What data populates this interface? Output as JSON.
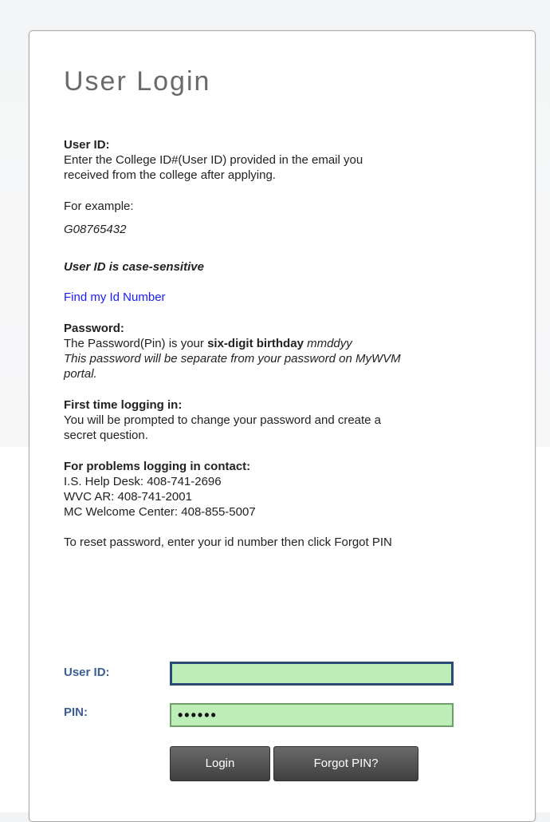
{
  "title": "User Login",
  "user_id_section": {
    "heading": "User ID:",
    "line1": "Enter the College ID#(User ID) provided in the email you",
    "line2": "received from the college after applying."
  },
  "example": {
    "label": "For example:",
    "value": "G08765432"
  },
  "case_note": "User ID is case-sensitive",
  "find_link": "Find my Id Number",
  "password_section": {
    "heading": "Password:",
    "line1_prefix": "The Password(Pin) is your ",
    "line1_bold": "six-digit birthday",
    "line1_italic": " mmddyy",
    "note_line1": "This password will be separate from your password on MyWVM",
    "note_line2": "portal."
  },
  "first_time": {
    "heading": "First time logging in:",
    "line1": "You will be prompted to change your password and create a",
    "line2": "secret question."
  },
  "problems": {
    "heading": "For problems logging in contact:",
    "line1": "I.S. Help Desk: 408-741-2696",
    "line2": "WVC AR: 408-741-2001",
    "line3": "MC Welcome Center: 408-855-5007"
  },
  "reset_note": "To reset password, enter your id number then click Forgot PIN",
  "form": {
    "user_id_label": "User ID:",
    "user_id_value": "",
    "pin_label": "PIN:",
    "pin_value": "••••••",
    "login_label": "Login",
    "forgot_label": "Forgot PIN?"
  },
  "colors": {
    "field_bg": "#bdeeb8",
    "label_blue": "#3b5e94",
    "link_blue": "#1a1aff",
    "button_dark": "#4a4a4a"
  }
}
